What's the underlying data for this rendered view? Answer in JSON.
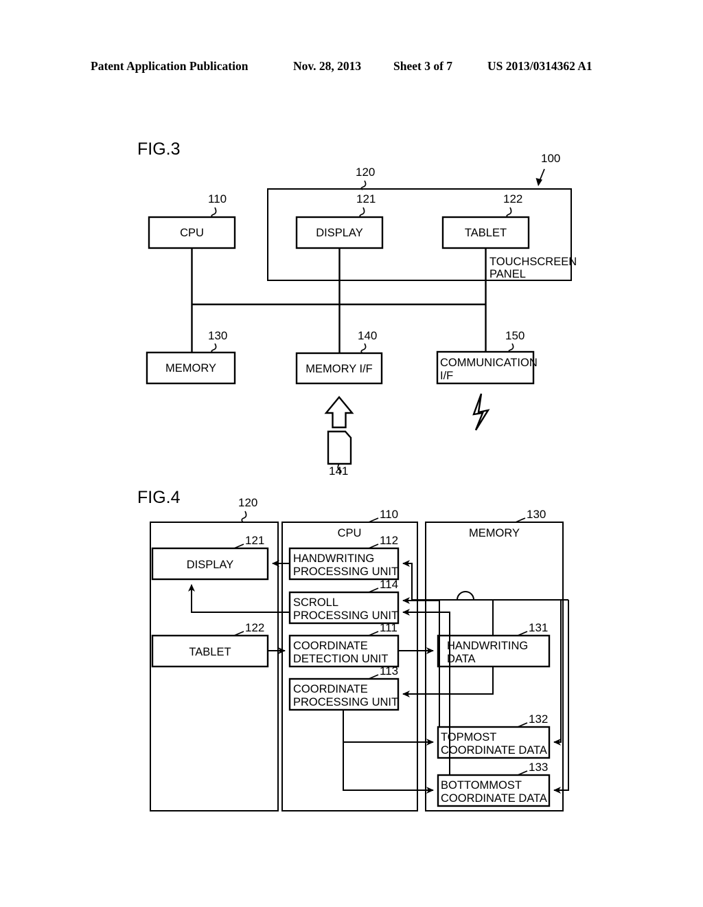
{
  "header": {
    "publication": "Patent Application Publication",
    "date": "Nov. 28, 2013",
    "sheet": "Sheet 3 of 7",
    "number": "US 2013/0314362 A1"
  },
  "fig3": {
    "title": "FIG.3",
    "refs": {
      "system": "100",
      "cpu": "110",
      "touchscreen_panel": "120",
      "display": "121",
      "tablet": "122",
      "memory": "130",
      "memory_if": "140",
      "card": "141",
      "communication_if": "150"
    },
    "boxes": {
      "cpu": "CPU",
      "display": "DISPLAY",
      "tablet": "TABLET",
      "memory": "MEMORY",
      "memory_if": "MEMORY I/F",
      "communication_if_line1": "COMMUNICATION",
      "communication_if_line2": "I/F"
    },
    "panel_label_line1": "TOUCHSCREEN",
    "panel_label_line2": "PANEL"
  },
  "fig4": {
    "title": "FIG.4",
    "refs": {
      "touchscreen_panel": "120",
      "display": "121",
      "tablet": "122",
      "cpu": "110",
      "coordinate_detection_unit": "111",
      "handwriting_processing_unit": "112",
      "coordinate_processing_unit": "113",
      "scroll_processing_unit": "114",
      "memory": "130",
      "handwriting_data": "131",
      "topmost_coordinate_data": "132",
      "bottommost_coordinate_data": "133"
    },
    "groups": {
      "cpu": "CPU",
      "memory": "MEMORY"
    },
    "boxes": {
      "display": "DISPLAY",
      "tablet": "TABLET",
      "handwriting_processing_unit_line1": "HANDWRITING",
      "handwriting_processing_unit_line2": "PROCESSING UNIT",
      "scroll_processing_unit_line1": "SCROLL",
      "scroll_processing_unit_line2": "PROCESSING UNIT",
      "coordinate_detection_unit_line1": "COORDINATE",
      "coordinate_detection_unit_line2": "DETECTION UNIT",
      "coordinate_processing_unit_line1": "COORDINATE",
      "coordinate_processing_unit_line2": "PROCESSING UNIT",
      "handwriting_data_line1": "HANDWRITING",
      "handwriting_data_line2": "DATA",
      "topmost_coordinate_data_line1": "TOPMOST",
      "topmost_coordinate_data_line2": "COORDINATE DATA",
      "bottommost_coordinate_data_line1": "BOTTOMMOST",
      "bottommost_coordinate_data_line2": "COORDINATE DATA"
    }
  },
  "colors": {
    "ink": "#000000",
    "paper": "#ffffff"
  }
}
